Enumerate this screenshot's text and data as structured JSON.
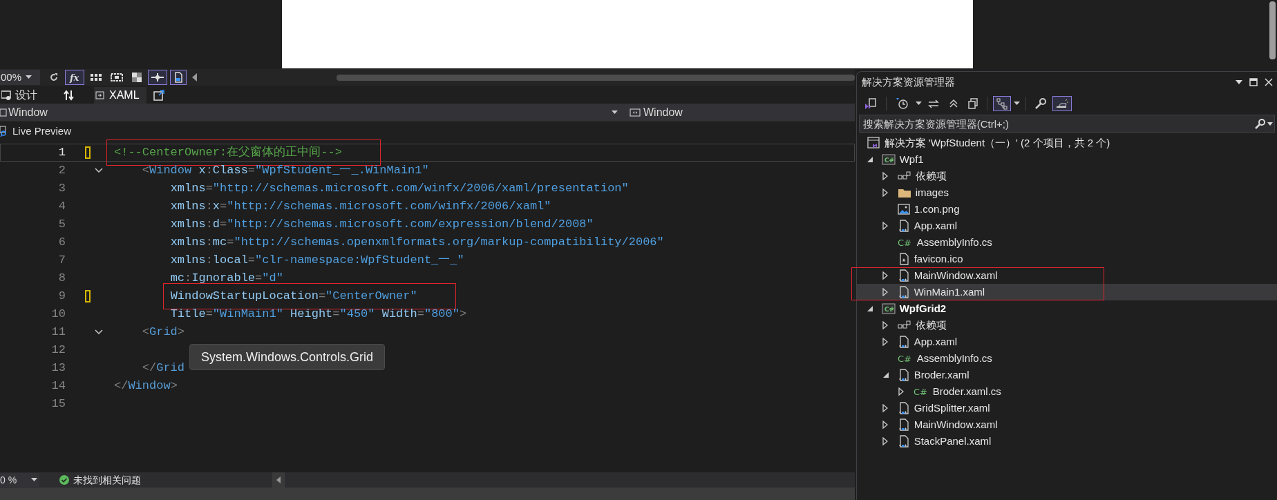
{
  "designer": {
    "zoom": "00%",
    "tools": [
      {
        "kind": "refresh",
        "pressed": false
      },
      {
        "kind": "fx",
        "pressed": true
      },
      {
        "kind": "grid",
        "pressed": false
      },
      {
        "kind": "frame",
        "pressed": false
      },
      {
        "kind": "checker",
        "pressed": false
      },
      {
        "kind": "crosshair",
        "pressed": true
      },
      {
        "kind": "device",
        "pressed": true
      }
    ]
  },
  "view_tabs": [
    {
      "label": "设计",
      "selected": false
    },
    {
      "label": "XAML",
      "selected": true
    }
  ],
  "element_bar": {
    "left": "Window",
    "right": "Window"
  },
  "live_preview": "Live Preview",
  "editor": {
    "lines": [
      {
        "number": "1",
        "current": true,
        "changed": true,
        "annotated": true,
        "tokens": [
          {
            "kind": "comment",
            "text": "<!--CenterOwner:在父窗体的正中间-->"
          }
        ]
      },
      {
        "number": "2",
        "current": false,
        "changed": false,
        "expanded": true,
        "annotated": false,
        "tokens": [
          {
            "kind": "delim",
            "text": "    <"
          },
          {
            "kind": "element",
            "text": "Window"
          },
          {
            "kind": "attr",
            "text": " x"
          },
          {
            "kind": "delim",
            "text": ":"
          },
          {
            "kind": "attr",
            "text": "Class"
          },
          {
            "kind": "delim",
            "text": "="
          },
          {
            "kind": "value",
            "text": "\"WpfStudent_一_.WinMain1\""
          }
        ]
      },
      {
        "number": "3",
        "current": false,
        "changed": false,
        "annotated": false,
        "tokens": [
          {
            "kind": "attr",
            "text": "        xmlns"
          },
          {
            "kind": "delim",
            "text": "="
          },
          {
            "kind": "value",
            "text": "\"http://schemas.microsoft.com/winfx/2006/xaml/presentation\""
          }
        ]
      },
      {
        "number": "4",
        "current": false,
        "changed": false,
        "annotated": false,
        "tokens": [
          {
            "kind": "attr",
            "text": "        xmlns"
          },
          {
            "kind": "delim",
            "text": ":"
          },
          {
            "kind": "attr",
            "text": "x"
          },
          {
            "kind": "delim",
            "text": "="
          },
          {
            "kind": "value",
            "text": "\"http://schemas.microsoft.com/winfx/2006/xaml\""
          }
        ]
      },
      {
        "number": "5",
        "current": false,
        "changed": false,
        "annotated": false,
        "tokens": [
          {
            "kind": "attr",
            "text": "        xmlns"
          },
          {
            "kind": "delim",
            "text": ":"
          },
          {
            "kind": "attr",
            "text": "d"
          },
          {
            "kind": "delim",
            "text": "="
          },
          {
            "kind": "value",
            "text": "\"http://schemas.microsoft.com/expression/blend/2008\""
          }
        ]
      },
      {
        "number": "6",
        "current": false,
        "changed": false,
        "annotated": false,
        "tokens": [
          {
            "kind": "attr",
            "text": "        xmlns"
          },
          {
            "kind": "delim",
            "text": ":"
          },
          {
            "kind": "attr",
            "text": "mc"
          },
          {
            "kind": "delim",
            "text": "="
          },
          {
            "kind": "value",
            "text": "\"http://schemas.openxmlformats.org/markup-compatibility/2006\""
          }
        ]
      },
      {
        "number": "7",
        "current": false,
        "changed": false,
        "annotated": false,
        "tokens": [
          {
            "kind": "attr",
            "text": "        xmlns"
          },
          {
            "kind": "delim",
            "text": ":"
          },
          {
            "kind": "attr",
            "text": "local"
          },
          {
            "kind": "delim",
            "text": "="
          },
          {
            "kind": "value",
            "text": "\"clr-namespace:WpfStudent_一_\""
          }
        ]
      },
      {
        "number": "8",
        "current": false,
        "changed": false,
        "annotated": false,
        "tokens": [
          {
            "kind": "attr",
            "text": "        mc"
          },
          {
            "kind": "delim",
            "text": ":"
          },
          {
            "kind": "attr",
            "text": "Ignorable"
          },
          {
            "kind": "delim",
            "text": "="
          },
          {
            "kind": "value",
            "text": "\"d\""
          }
        ]
      },
      {
        "number": "9",
        "current": false,
        "changed": true,
        "annotated": true,
        "tokens": [
          {
            "kind": "attr",
            "text": "        WindowStartupLocation"
          },
          {
            "kind": "delim",
            "text": "="
          },
          {
            "kind": "value",
            "text": "\"CenterOwner\""
          }
        ]
      },
      {
        "number": "10",
        "current": false,
        "changed": false,
        "annotated": false,
        "tokens": [
          {
            "kind": "attr",
            "text": "        Title"
          },
          {
            "kind": "delim",
            "text": "="
          },
          {
            "kind": "value",
            "text": "\"WinMain1\""
          },
          {
            "kind": "attr",
            "text": " Height"
          },
          {
            "kind": "delim",
            "text": "="
          },
          {
            "kind": "value",
            "text": "\"450\""
          },
          {
            "kind": "attr",
            "text": " Width"
          },
          {
            "kind": "delim",
            "text": "="
          },
          {
            "kind": "value",
            "text": "\"800\""
          },
          {
            "kind": "delim",
            "text": ">"
          }
        ]
      },
      {
        "number": "11",
        "current": false,
        "changed": false,
        "expanded": true,
        "annotated": false,
        "tokens": [
          {
            "kind": "delim",
            "text": "    <"
          },
          {
            "kind": "element",
            "text": "Grid"
          },
          {
            "kind": "delim",
            "text": ">"
          }
        ]
      },
      {
        "number": "12",
        "current": false,
        "changed": false
      },
      {
        "number": "13",
        "current": false,
        "changed": false,
        "annotated": false,
        "tokens": [
          {
            "kind": "delim",
            "text": "    </"
          },
          {
            "kind": "element",
            "text": "Grid"
          }
        ]
      },
      {
        "number": "14",
        "current": false,
        "changed": false,
        "annotated": false,
        "tokens": [
          {
            "kind": "delim",
            "text": "</"
          },
          {
            "kind": "element",
            "text": "Window"
          },
          {
            "kind": "delim",
            "text": ">"
          }
        ]
      },
      {
        "number": "15",
        "current": false,
        "changed": false
      }
    ]
  },
  "tooltip": "System.Windows.Controls.Grid",
  "status": {
    "zoom": "0 %",
    "issues": "未找到相关问题"
  },
  "solution_explorer": {
    "title": "解决方案资源管理器",
    "tools": [
      {
        "kind": "home",
        "pressed": false
      },
      {
        "kind": "history",
        "pressed": false
      },
      {
        "kind": "sync",
        "pressed": false
      },
      {
        "kind": "collapse",
        "pressed": false
      },
      {
        "kind": "copy",
        "pressed": false
      },
      {
        "kind": "view",
        "pressed": true
      },
      {
        "kind": "wrench",
        "pressed": false
      },
      {
        "kind": "preview",
        "pressed": true
      }
    ],
    "search": {
      "placeholder": "搜索解决方案资源管理器(Ctrl+;)"
    },
    "tree": [
      {
        "label": "解决方案 'WpfStudent（一）' (2 个项目，共 2 个)",
        "kind": "solution",
        "bold": false,
        "selected": false,
        "annotated": false
      },
      {
        "label": "Wpf1",
        "kind": "csproj",
        "icon_text": "C#",
        "expanded": true,
        "bold": false,
        "selected": false,
        "annotated": false,
        "children": [
          {
            "label": "依赖项",
            "kind": "deps",
            "expanded": false,
            "bold": false,
            "selected": false,
            "annotated": false
          },
          {
            "label": "images",
            "kind": "folder",
            "expanded": false,
            "bold": false,
            "selected": false,
            "annotated": false
          },
          {
            "label": "1.con.png",
            "kind": "image",
            "bold": false,
            "selected": false,
            "annotated": false
          },
          {
            "label": "App.xaml",
            "kind": "xaml",
            "expanded": false,
            "bold": false,
            "selected": false,
            "annotated": false
          },
          {
            "label": "AssemblyInfo.cs",
            "kind": "cs",
            "icon_text": "C#",
            "bold": false,
            "selected": false,
            "annotated": false
          },
          {
            "label": "favicon.ico",
            "kind": "ico",
            "bold": false,
            "selected": false,
            "annotated": false
          },
          {
            "label": "MainWindow.xaml",
            "kind": "xaml",
            "expanded": false,
            "bold": false,
            "selected": false,
            "annotated": true
          },
          {
            "label": "WinMain1.xaml",
            "kind": "xaml",
            "expanded": false,
            "bold": false,
            "selected": true,
            "annotated": true
          }
        ]
      },
      {
        "label": "WpfGrid2",
        "kind": "csproj",
        "icon_text": "C#",
        "expanded": true,
        "bold": true,
        "selected": false,
        "annotated": false,
        "children": [
          {
            "label": "依赖项",
            "kind": "deps",
            "expanded": false,
            "bold": false,
            "selected": false,
            "annotated": false
          },
          {
            "label": "App.xaml",
            "kind": "xaml",
            "expanded": false,
            "bold": false,
            "selected": false,
            "annotated": false
          },
          {
            "label": "AssemblyInfo.cs",
            "kind": "cs",
            "icon_text": "C#",
            "bold": false,
            "selected": false,
            "annotated": false
          },
          {
            "label": "Broder.xaml",
            "kind": "xaml",
            "expanded": true,
            "bold": false,
            "selected": false,
            "annotated": false,
            "children": [
              {
                "label": "Broder.xaml.cs",
                "kind": "cs",
                "icon_text": "C#",
                "expanded": false,
                "bold": false,
                "selected": false,
                "annotated": false
              }
            ]
          },
          {
            "label": "GridSplitter.xaml",
            "kind": "xaml",
            "expanded": false,
            "bold": false,
            "selected": false,
            "annotated": false
          },
          {
            "label": "MainWindow.xaml",
            "kind": "xaml",
            "expanded": false,
            "bold": false,
            "selected": false,
            "annotated": false
          },
          {
            "label": "StackPanel.xaml",
            "kind": "xaml",
            "expanded": false,
            "bold": false,
            "selected": false,
            "annotated": false
          }
        ]
      }
    ]
  }
}
